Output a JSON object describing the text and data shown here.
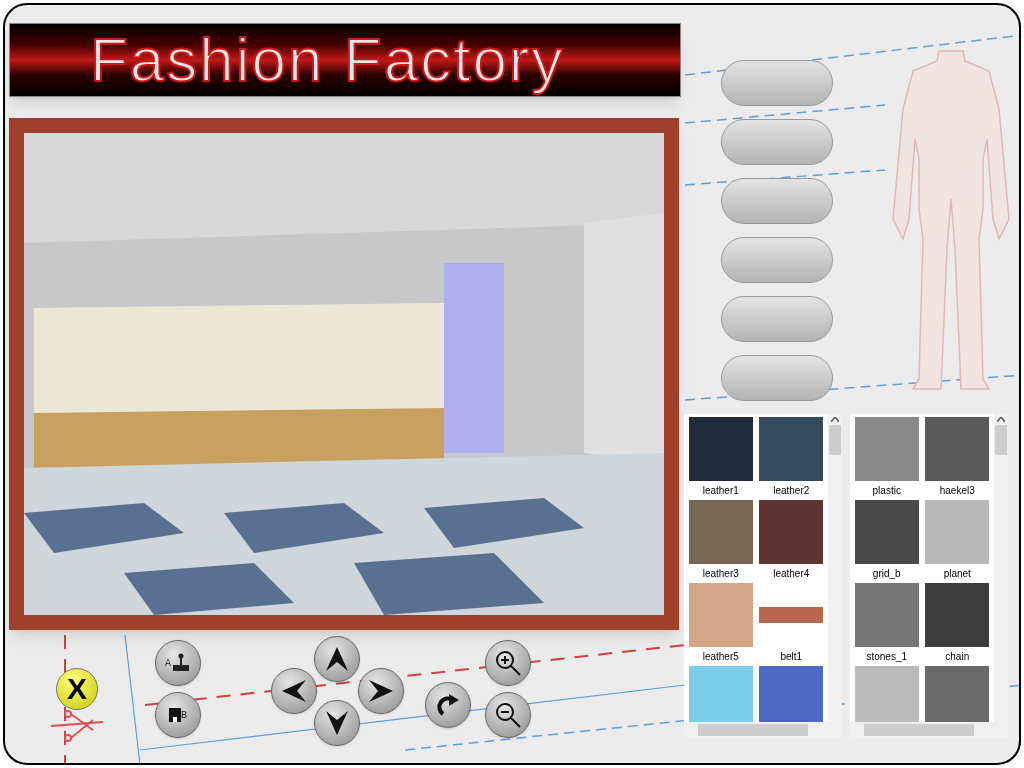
{
  "title": "Fashion Factory",
  "controls": {
    "close_label": "X",
    "joystick_label": "A",
    "save_label": "B"
  },
  "pill_buttons": [
    {
      "kind": "blank"
    },
    {
      "kind": "blank"
    },
    {
      "kind": "blank"
    },
    {
      "kind": "blank"
    },
    {
      "kind": "blank"
    },
    {
      "kind": "blank"
    }
  ],
  "texture_panels": [
    {
      "items": [
        {
          "name": "leather1",
          "color": "#1f2a3a"
        },
        {
          "name": "leather2",
          "color": "#34495a"
        },
        {
          "name": "leather3",
          "color": "#776656"
        },
        {
          "name": "leather4",
          "color": "#5e3532"
        },
        {
          "name": "leather5",
          "color": "#d4a68a"
        },
        {
          "name": "belt1",
          "color": "#b9674e",
          "kind": "strip"
        },
        {
          "color": "#7ccdea"
        },
        {
          "color": "#4d6bc4"
        }
      ]
    },
    {
      "items": [
        {
          "name": "plastic",
          "color": "#8a8a8a"
        },
        {
          "name": "haekel3",
          "color": "#5a5a5a"
        },
        {
          "name": "grid_b",
          "color": "#4a4a4a"
        },
        {
          "name": "planet",
          "color": "#b8b8b8"
        },
        {
          "name": "stones_1",
          "color": "#777777"
        },
        {
          "name": "chain",
          "color": "#3c3c3c"
        },
        {
          "color": "#bcbcbc"
        },
        {
          "color": "#6a6a6a"
        }
      ]
    }
  ]
}
